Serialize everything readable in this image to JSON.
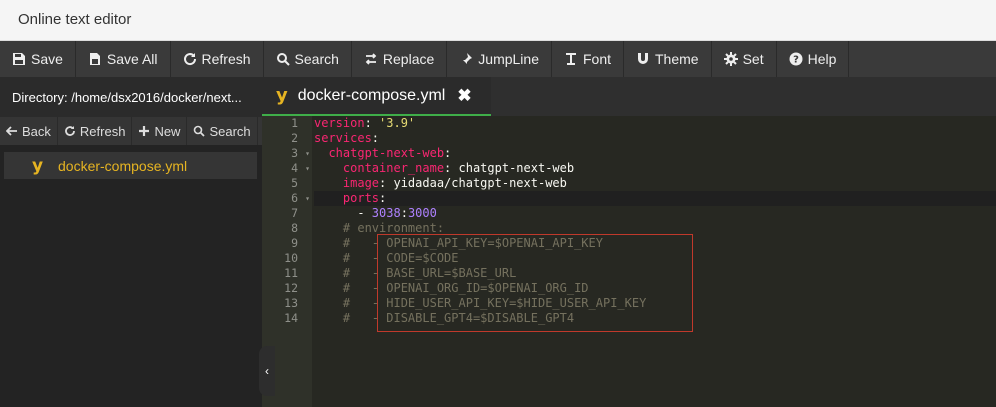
{
  "window": {
    "title": "Online text editor"
  },
  "toolbar": {
    "buttons": [
      {
        "label": "Save",
        "icon": "save-icon"
      },
      {
        "label": "Save All",
        "icon": "save-all-icon"
      },
      {
        "label": "Refresh",
        "icon": "refresh-icon"
      },
      {
        "label": "Search",
        "icon": "search-icon"
      },
      {
        "label": "Replace",
        "icon": "replace-icon"
      },
      {
        "label": "JumpLine",
        "icon": "pin-icon"
      },
      {
        "label": "Font",
        "icon": "font-icon"
      },
      {
        "label": "Theme",
        "icon": "magnet-icon"
      },
      {
        "label": "Set",
        "icon": "gear-icon"
      },
      {
        "label": "Help",
        "icon": "help-icon"
      }
    ]
  },
  "sidebar": {
    "directory": "Directory: /home/dsx2016/docker/next...",
    "actions": [
      {
        "label": "Back",
        "icon": "back-arrow-icon"
      },
      {
        "label": "Refresh",
        "icon": "refresh-icon"
      },
      {
        "label": "New",
        "icon": "plus-icon"
      },
      {
        "label": "Search",
        "icon": "search-icon"
      }
    ],
    "files": [
      {
        "name": "docker-compose.yml",
        "icon": "yaml-icon"
      }
    ]
  },
  "tab": {
    "label": "docker-compose.yml",
    "icon": "yaml-icon",
    "close": "✖"
  },
  "editor": {
    "line_numbers": [
      "1",
      "2",
      "3",
      "4",
      "5",
      "6",
      "7",
      "8",
      "9",
      "10",
      "11",
      "12",
      "13",
      "14"
    ],
    "fold_markers": {
      "3": "▾",
      "4": "▾",
      "6": "▾"
    },
    "active_line": 6,
    "lines": [
      [
        {
          "t": "version",
          "c": "k"
        },
        {
          "t": ": ",
          "c": ""
        },
        {
          "t": "'3.9'",
          "c": "s"
        }
      ],
      [
        {
          "t": "services",
          "c": "k"
        },
        {
          "t": ":",
          "c": ""
        }
      ],
      [
        {
          "t": "  chatgpt-next-web",
          "c": "k"
        },
        {
          "t": ":",
          "c": ""
        }
      ],
      [
        {
          "t": "    container_name",
          "c": "k"
        },
        {
          "t": ": chatgpt-next-web",
          "c": ""
        }
      ],
      [
        {
          "t": "    image",
          "c": "k"
        },
        {
          "t": ": yidadaa/chatgpt-next-web",
          "c": ""
        }
      ],
      [
        {
          "t": "    ports",
          "c": "k"
        },
        {
          "t": ":",
          "c": ""
        }
      ],
      [
        {
          "t": "      - ",
          "c": ""
        },
        {
          "t": "3038",
          "c": "n"
        },
        {
          "t": ":",
          "c": ""
        },
        {
          "t": "3000",
          "c": "n"
        }
      ],
      [
        {
          "t": "    # environment:",
          "c": "c"
        }
      ],
      [
        {
          "t": "    #   - OPENAI_API_KEY=$OPENAI_API_KEY",
          "c": "c"
        }
      ],
      [
        {
          "t": "    #   - CODE=$CODE",
          "c": "c"
        }
      ],
      [
        {
          "t": "    #   - BASE_URL=$BASE_URL",
          "c": "c"
        }
      ],
      [
        {
          "t": "    #   - OPENAI_ORG_ID=$OPENAI_ORG_ID",
          "c": "c"
        }
      ],
      [
        {
          "t": "    #   - HIDE_USER_API_KEY=$HIDE_USER_API_KEY",
          "c": "c"
        }
      ],
      [
        {
          "t": "    #   - DISABLE_GPT4=$DISABLE_GPT4",
          "c": "c"
        }
      ]
    ]
  },
  "colors": {
    "accent_tab_underline": "#3fae49",
    "yaml_icon": "#e6b422",
    "keyword": "#f92672",
    "string": "#e6db74",
    "number": "#ae81ff",
    "comment": "#75715e",
    "highlight_box": "#c0392b"
  },
  "sidebar_toggle": "‹"
}
